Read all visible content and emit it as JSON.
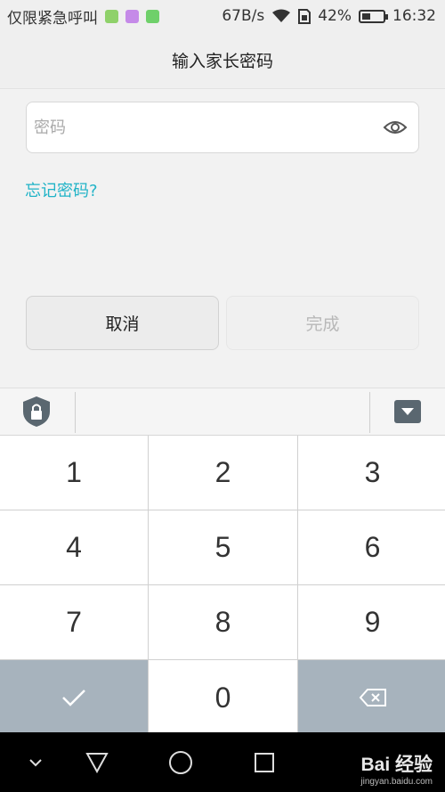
{
  "status_bar": {
    "carrier": "仅限紧急呼叫",
    "speed": "67B/s",
    "battery": "42%",
    "battery_level": 0.42,
    "time": "16:32",
    "app_icon_colors": [
      "#8fd16a",
      "#c58ae8",
      "#6fd06a"
    ]
  },
  "header": {
    "title": "输入家长密码"
  },
  "password": {
    "placeholder": "密码",
    "value": ""
  },
  "forgot_link": "忘记密码?",
  "buttons": {
    "cancel": "取消",
    "done": "完成"
  },
  "keypad": {
    "keys": [
      "1",
      "2",
      "3",
      "4",
      "5",
      "6",
      "7",
      "8",
      "9",
      "0"
    ]
  },
  "watermark": {
    "brand": "Bai 经验",
    "url": "jingyan.baidu.com"
  },
  "colors": {
    "accent": "#20b3c7",
    "dark_key": "#a7b3bd",
    "background": "#f2f2f2"
  }
}
